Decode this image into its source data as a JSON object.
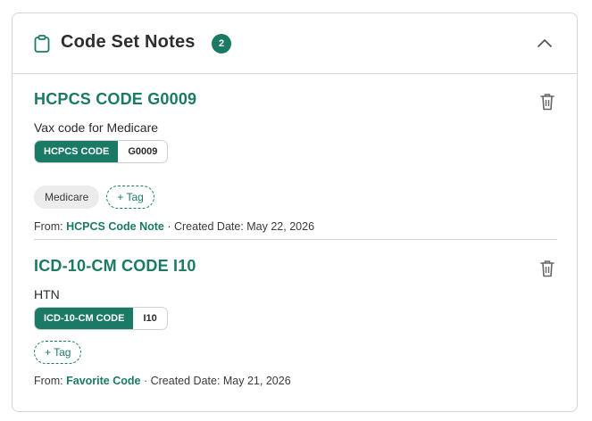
{
  "panel": {
    "title": "Code Set Notes",
    "count": "2"
  },
  "notes": [
    {
      "title": "HCPCS CODE G0009",
      "description": "Vax code for Medicare",
      "code_type": "HCPCS CODE",
      "code_value": "G0009",
      "tags": [
        "Medicare"
      ],
      "add_tag_label": "+ Tag",
      "from_label": "From:",
      "source": "HCPCS Code Note",
      "created_label": "· Created Date: May 22, 2026"
    },
    {
      "title": "ICD-10-CM CODE I10",
      "description": "HTN",
      "code_type": "ICD-10-CM CODE",
      "code_value": "I10",
      "tags": [],
      "add_tag_label": "+ Tag",
      "from_label": "From:",
      "source": "Favorite Code",
      "created_label": "· Created Date: May 21, 2026"
    }
  ],
  "colors": {
    "accent": "#1b7a64",
    "border": "#d5d5d5",
    "tag_bg": "#ececec"
  }
}
